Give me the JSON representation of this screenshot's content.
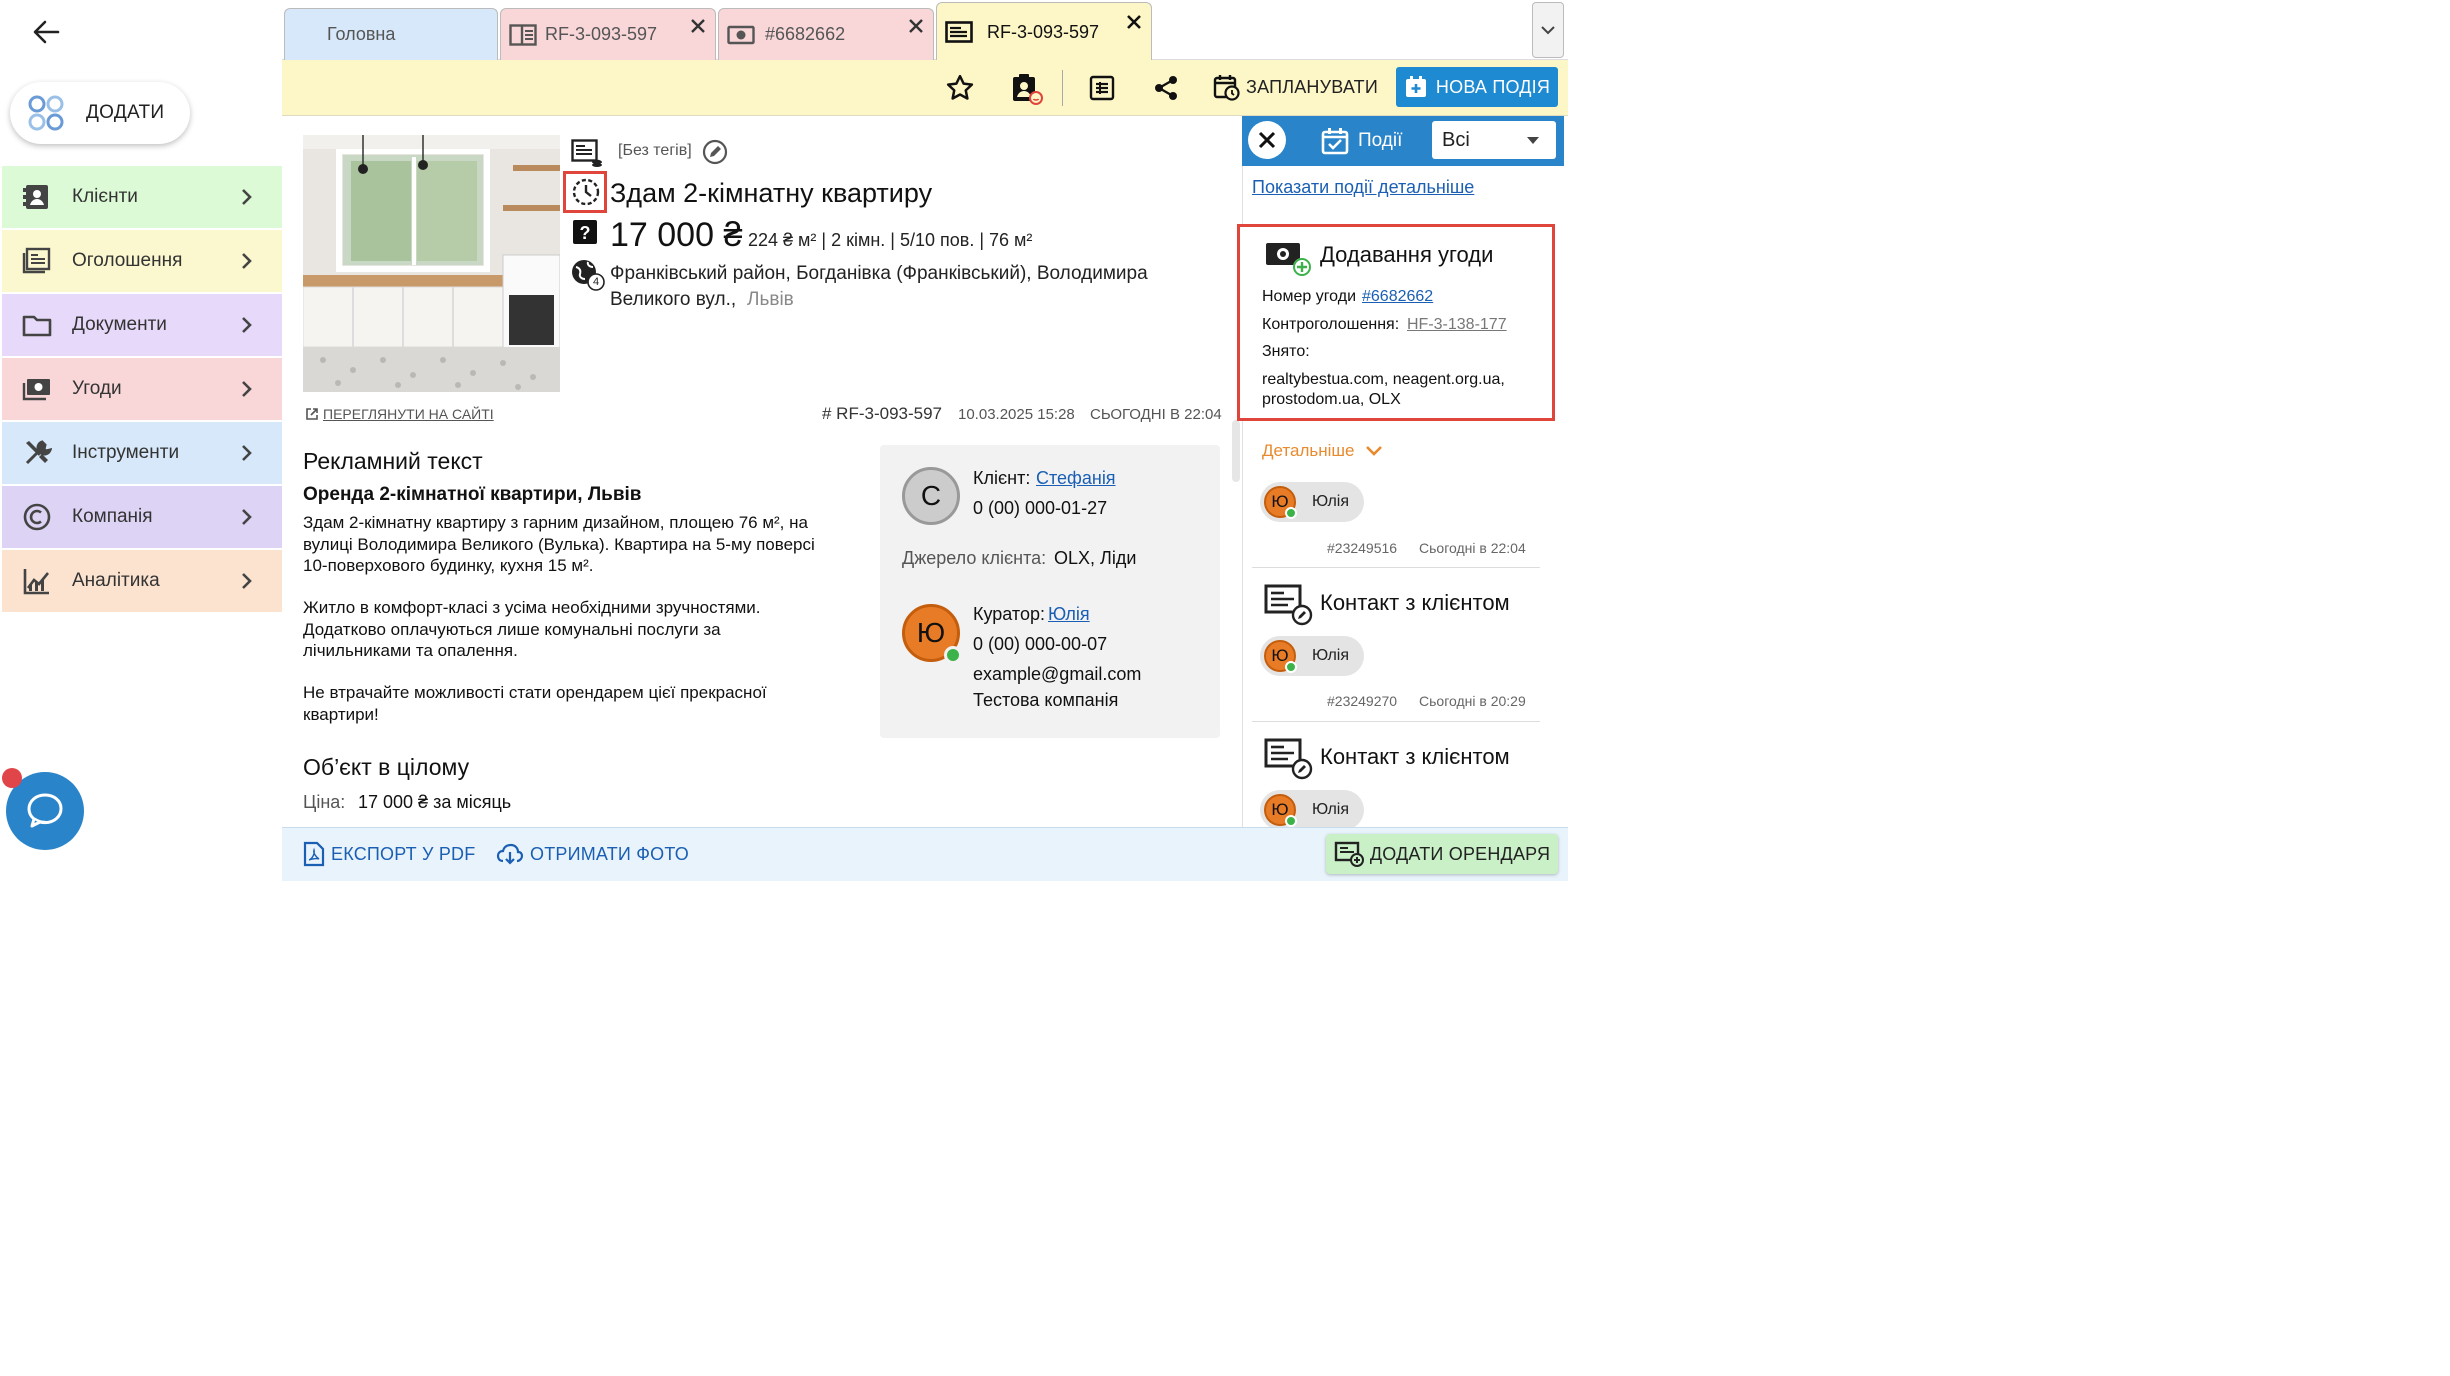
{
  "sidebar": {
    "add_label": "ДОДАТИ",
    "items": [
      {
        "label": "Клієнти",
        "bg": "#dcfad6",
        "icon": "clients-icon"
      },
      {
        "label": "Оголошення",
        "bg": "#fbf8cf",
        "icon": "listings-icon"
      },
      {
        "label": "Документи",
        "bg": "#e6d9f9",
        "icon": "folder-icon"
      },
      {
        "label": "Угоди",
        "bg": "#f9d7d9",
        "icon": "deals-icon"
      },
      {
        "label": "Інструменти",
        "bg": "#d6e8f9",
        "icon": "tools-icon"
      },
      {
        "label": "Компанія",
        "bg": "#ddd3f5",
        "icon": "company-icon"
      },
      {
        "label": "Аналітика",
        "bg": "#fbe3d0",
        "icon": "analytics-icon"
      }
    ]
  },
  "tabs": [
    {
      "label": "Головна",
      "bg": "#d6e8f9"
    },
    {
      "label": "RF-3-093-597",
      "bg": "#f9d7d9"
    },
    {
      "label": "#6682662",
      "bg": "#f9d7d9"
    },
    {
      "label": "RF-3-093-597",
      "bg": "#fdf7c8"
    }
  ],
  "toolbar": {
    "schedule_label": "ЗАПЛАНУВАТИ",
    "new_event_label": "НОВА ПОДІЯ"
  },
  "listing": {
    "tags": "[Без тегів]",
    "title": "Здам 2-кімнатну квартиру",
    "price": "17 000 ₴",
    "specs": "224 ₴ м² | 2 кімн. | 5/10 пов. | 76 м²",
    "address_line1": "Франківський район, Богданівка (Франківський), Володимира",
    "address_line2": "Великого вул.,",
    "city": "Львів",
    "globe_badge": "4",
    "view_on_site": "ПЕРЕГЛЯНУТИ НА САЙТІ",
    "id": "# RF-3-093-597",
    "created": "10.03.2025 15:28",
    "updated": "СЬОГОДНІ В 22:04"
  },
  "ad": {
    "heading": "Рекламний текст",
    "subheading": "Оренда 2-кімнатної квартири, Львів",
    "p1": [
      "Здам 2-кімнатну квартиру з гарним дизайном, площею 76 м², на",
      "вулиці Володимира Великого (Вулька). Квартира на 5-му поверсі",
      "10-поверхового будинку, кухня 15 м²."
    ],
    "p2": [
      "Житло в комфорт-класі з усіма необхідними зручностями.",
      "Додатково оплачуються лише комунальні послуги за",
      "лічильниками та опалення."
    ],
    "p3": [
      "Не втрачайте можливості стати орендарем цієї прекрасної",
      "квартири!"
    ]
  },
  "object": {
    "heading": "Об’єкт в цілому",
    "price_label": "Ціна:",
    "price_value": "17 000 ₴ за місяць"
  },
  "contact_card": {
    "client_avatar": "С",
    "client_label": "Клієнт:",
    "client_name": "Стефанія",
    "client_phone": "0 (00) 000-01-27",
    "source_label": "Джерело клієнта:",
    "source_value": "OLX, Ліди",
    "curator_avatar": "Ю",
    "curator_label": "Куратор:",
    "curator_name": "Юлія",
    "curator_phone": "0 (00) 000-00-07",
    "curator_email": "example@gmail.com",
    "curator_company": "Тестова компанія"
  },
  "events_panel": {
    "events_label": "Події",
    "filter_value": "Всі",
    "show_details_link": "Показати події детальніше",
    "highlight": {
      "title": "Додавання угоди",
      "deal_label": "Номер угоди",
      "deal_value": "#6682662",
      "counter_label": "Контроголошення:",
      "counter_value": "HF-3-138-177",
      "removed_label": "Знято:",
      "removed_line1": "realtybestua.com, neagent.org.ua,",
      "removed_line2": "prostodom.ua, OLX"
    },
    "more_label": "Детальніше",
    "user_name": "Юлія",
    "user_avatar": "Ю",
    "event1_id": "#23249516",
    "event1_time": "Сьогодні в 22:04",
    "event2_title": "Контакт з клієнтом",
    "event2_id": "#23249270",
    "event2_time": "Сьогодні в 20:29",
    "event3_title": "Контакт з клієнтом"
  },
  "bottom": {
    "export_pdf": "ЕКСПОРТ У PDF",
    "get_photo": "ОТРИМАТИ ФОТО",
    "add_tenant": "ДОДАТИ ОРЕНДАРЯ"
  },
  "colors": {
    "accent": "#1e8ad2",
    "highlight_border": "#e0453b",
    "orange": "#e87b26"
  }
}
